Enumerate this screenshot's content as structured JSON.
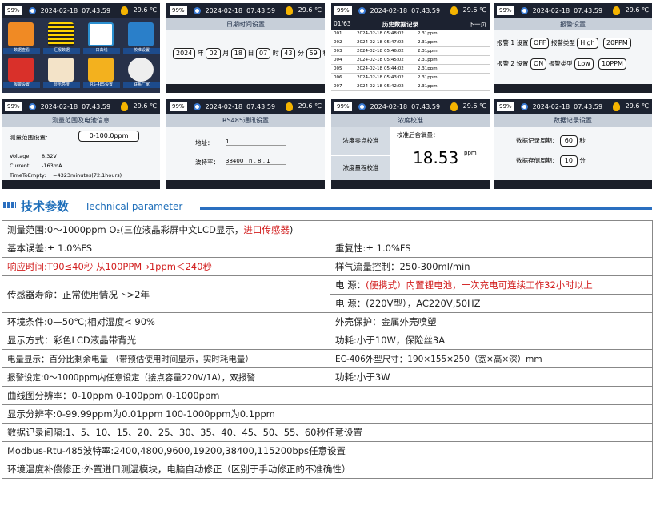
{
  "status": {
    "battery": "99%",
    "date": "2024-02-18",
    "time": "07:43:59",
    "temp": "29.6 ℃"
  },
  "screen1": {
    "labels": [
      "数据查看",
      "汇报数据",
      "口曲线",
      "校准设置",
      "报警设置",
      "显示亮度",
      "RS-485设置",
      "联系厂家"
    ]
  },
  "screen2": {
    "title": "日期时间设置",
    "year": "2024",
    "y": "年",
    "month": "02",
    "m": "月",
    "day": "18",
    "d": "日",
    "hour": "07",
    "h": "时",
    "min": "43",
    "mi": "分",
    "sec": "59",
    "s": "秒"
  },
  "screen3": {
    "page": "01/63",
    "title": "历史数据记录",
    "next": "下一页",
    "rows": [
      [
        "001",
        "2024-02-18",
        "05:48:02",
        "2.31ppm"
      ],
      [
        "002",
        "2024-02-18",
        "05:47:02",
        "2.31ppm"
      ],
      [
        "003",
        "2024-02-18",
        "05:46:02",
        "2.31ppm"
      ],
      [
        "004",
        "2024-02-18",
        "05:45:02",
        "2.31ppm"
      ],
      [
        "005",
        "2024-02-18",
        "05:44:02",
        "2.31ppm"
      ],
      [
        "006",
        "2024-02-18",
        "05:43:02",
        "2.31ppm"
      ],
      [
        "007",
        "2024-02-18",
        "05:42:02",
        "2.31ppm"
      ],
      [
        "008",
        "2024-02-18",
        "05:41:02",
        "2.31ppm"
      ]
    ]
  },
  "screen4": {
    "title": "报警设置",
    "a1": "报警 1 设置",
    "a1v": "OFF",
    "t": "报警类型",
    "t1": "High",
    "v1": "20PPM",
    "a2": "报警 2 设置",
    "a2v": "ON",
    "t2": "Low",
    "v2": "10PPM"
  },
  "screen5": {
    "title": "测量范围及电池信息",
    "range_label": "测量范围设置:",
    "range": "0-100.0ppm",
    "voltage_l": "Voltage:",
    "voltage": "8.32V",
    "current_l": "Current:",
    "current": "-163mA",
    "tte_l": "TimeToEmpty:",
    "tte": "≈4323minutes(72.1hours)"
  },
  "screen6": {
    "title": "RS485通讯设置",
    "addr_l": "地址：",
    "addr": "1",
    "baud_l": "波特率：",
    "baud": "38400 , n , 8 , 1"
  },
  "screen7": {
    "title": "浓度校准",
    "zero": "浓度零点校准",
    "span": "浓度量程校准",
    "after": "校准后含氧量：",
    "value": "18.53",
    "unit": "ppm"
  },
  "screen8": {
    "title": "数据记录设置",
    "rec_l": "数据记录周期：",
    "rec": "60",
    "rec_u": "秒",
    "store_l": "数据存储周期：",
    "store": "10",
    "store_u": "分"
  },
  "section": {
    "title": "技术参数",
    "subtitle": "Technical parameter"
  },
  "spec": {
    "r1": "测量范围:0～1000ppm O₂(三位液晶彩屏中文LCD显示，",
    "r1red": "进口传感器",
    "r1end": ")",
    "r2a": "基本误差:± 1.0%FS",
    "r2b": "重复性:± 1.0%FS",
    "r3a": "响应时间:T90≤40秒  从100PPM→1ppm＜240秒",
    "r3b": "样气流量控制：250-300ml/min",
    "r4a": "传感器寿命：正常使用情况下>2年",
    "r4b1": "电  源：",
    "r4b1red": "(便携式）内置锂电池，一次充电可连续工作32小时以上",
    "r4b2": "电  源：(220V型），AC220V,50HZ",
    "r5a": "环境条件:0—50℃;相对湿度< 90%",
    "r5b": "外壳保护：金属外壳喷塑",
    "r6a": "显示方式：彩色LCD液晶带背光",
    "r6b": "功耗:小于10W，保险丝3A",
    "r7a": "电量显示：百分比剩余电量 （带预估使用时间显示，实时耗电量）",
    "r7b": "EC-406外型尺寸：190×155×250（宽×高×深）mm",
    "r8a": "报警设定:0～1000ppm内任意设定（接点容量220V/1A），双报警",
    "r8b": "功耗:小于3W",
    "r9": "曲线图分辨率：0-10ppm 0-100ppm 0-1000ppm",
    "r10": "显示分辨率:0-99.99ppm为0.01ppm   100-1000ppm为0.1ppm",
    "r11": "数据记录间隔:1、5、10、15、20、25、30、35、40、45、50、55、60秒任意设置",
    "r12": "Modbus-Rtu-485波特率:2400,4800,9600,19200,38400,115200bps任意设置",
    "r13": "环境温度补偿修正:外置进口测温模块，电脑自动修正（区别于手动修正的不准确性）"
  }
}
